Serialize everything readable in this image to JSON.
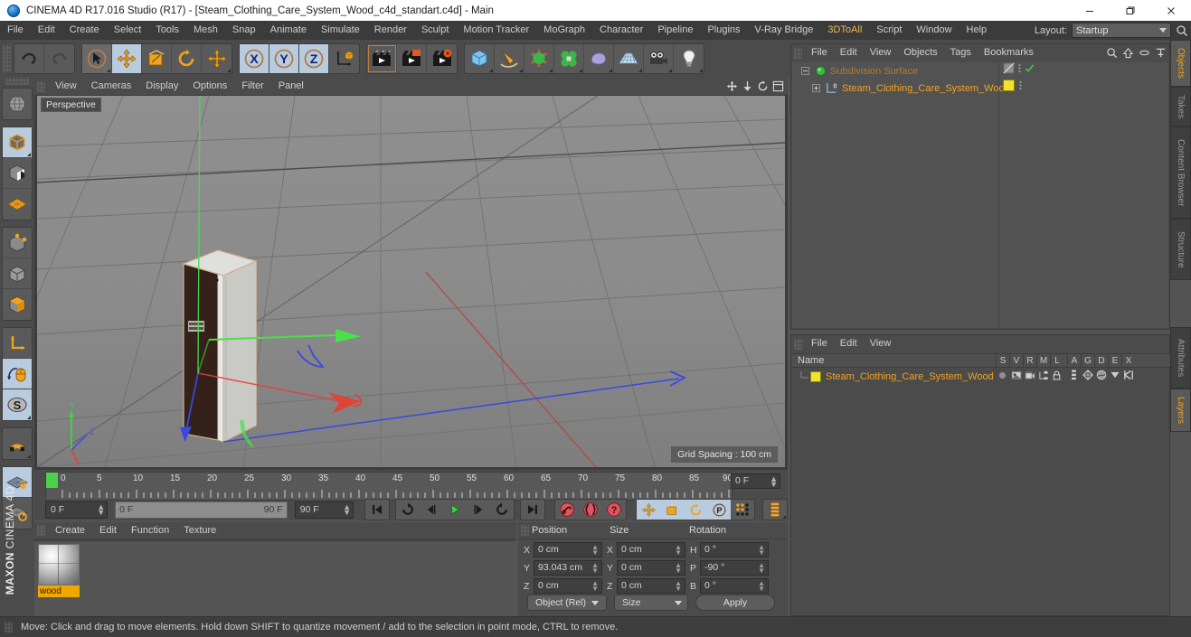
{
  "window": {
    "title": "CINEMA 4D R17.016 Studio (R17) - [Steam_Clothing_Care_System_Wood_c4d_standart.c4d] - Main",
    "app_icon": "c4d-logo-icon",
    "minimize": "minimize-icon",
    "maximize": "maximize-icon",
    "close": "close-icon"
  },
  "menubar": {
    "items": [
      {
        "label": "File"
      },
      {
        "label": "Edit"
      },
      {
        "label": "Create"
      },
      {
        "label": "Select"
      },
      {
        "label": "Tools"
      },
      {
        "label": "Mesh"
      },
      {
        "label": "Snap"
      },
      {
        "label": "Animate"
      },
      {
        "label": "Simulate"
      },
      {
        "label": "Render"
      },
      {
        "label": "Sculpt"
      },
      {
        "label": "Motion Tracker"
      },
      {
        "label": "MoGraph"
      },
      {
        "label": "Character"
      },
      {
        "label": "Pipeline"
      },
      {
        "label": "Plugins"
      },
      {
        "label": "V-Ray Bridge"
      },
      {
        "label": "3DToAll"
      },
      {
        "label": "Script"
      },
      {
        "label": "Window"
      },
      {
        "label": "Help"
      }
    ],
    "layout_label": "Layout:",
    "layout_value": "Startup",
    "search_icon": "search-icon"
  },
  "toolbar": {
    "groups": [
      {
        "buttons": [
          {
            "name": "undo-button",
            "icon": "undo-arrow-icon",
            "state": "normal"
          },
          {
            "name": "redo-button",
            "icon": "redo-arrow-icon",
            "state": "disabled"
          }
        ]
      },
      {
        "buttons": [
          {
            "name": "live-selection-tool",
            "icon": "cursor-arrow-icon",
            "state": "normal"
          },
          {
            "name": "move-tool",
            "icon": "move-cross-icon",
            "state": "selected"
          },
          {
            "name": "scale-tool",
            "icon": "scale-square-icon",
            "state": "normal"
          },
          {
            "name": "rotate-tool",
            "icon": "rotate-circle-icon",
            "state": "normal"
          },
          {
            "name": "dynamic-place-tool",
            "icon": "move-cross-icon",
            "state": "normal"
          }
        ]
      },
      {
        "buttons": [
          {
            "name": "x-axis-lock",
            "icon": "axis-x-icon",
            "state": "selected",
            "label": "X"
          },
          {
            "name": "y-axis-lock",
            "icon": "axis-y-icon",
            "state": "selected",
            "label": "Y"
          },
          {
            "name": "z-axis-lock",
            "icon": "axis-z-icon",
            "state": "selected",
            "label": "Z"
          },
          {
            "name": "world-object-coordinate-toggle",
            "icon": "world-axis-cube-icon",
            "state": "normal"
          }
        ]
      },
      {
        "buttons": [
          {
            "name": "render-view-button",
            "icon": "render-clapper-icon",
            "state": "active"
          },
          {
            "name": "render-region-button",
            "icon": "render-region-clapper-icon",
            "state": "normal"
          },
          {
            "name": "render-settings-button",
            "icon": "render-settings-clapper-icon",
            "state": "normal"
          }
        ]
      },
      {
        "buttons": [
          {
            "name": "add-cube-object",
            "icon": "cube-icon",
            "state": "normal"
          },
          {
            "name": "add-spline-object",
            "icon": "pen-spline-icon",
            "state": "normal"
          },
          {
            "name": "add-generator-object",
            "icon": "green-cube-generator-icon",
            "state": "normal"
          },
          {
            "name": "add-deformer-object",
            "icon": "green-clover-deformer-icon",
            "state": "normal"
          },
          {
            "name": "add-scene-object",
            "icon": "blob-environment-icon",
            "state": "normal"
          },
          {
            "name": "add-floor-object",
            "icon": "floor-grid-icon",
            "state": "normal"
          },
          {
            "name": "add-camera-object",
            "icon": "camera-icon",
            "state": "normal"
          },
          {
            "name": "add-light-object",
            "icon": "lightbulb-icon",
            "state": "normal"
          }
        ]
      }
    ]
  },
  "left_toolbar": {
    "groups": [
      {
        "buttons": [
          {
            "name": "make-editable-button",
            "icon": "make-editable-sphere-icon",
            "state": "normal"
          }
        ]
      },
      {
        "buttons": [
          {
            "name": "model-mode-button",
            "icon": "model-cube-icon",
            "state": "selected"
          },
          {
            "name": "texture-mode-button",
            "icon": "texture-checker-cube-icon",
            "state": "normal"
          },
          {
            "name": "workplane-mode-button",
            "icon": "workplane-grid-icon",
            "state": "normal"
          }
        ]
      },
      {
        "buttons": [
          {
            "name": "points-mode-button",
            "icon": "points-cube-icon",
            "state": "normal"
          },
          {
            "name": "edges-mode-button",
            "icon": "edges-cube-icon",
            "state": "normal"
          },
          {
            "name": "polygons-mode-button",
            "icon": "polygons-cube-icon",
            "state": "normal"
          }
        ]
      },
      {
        "buttons": [
          {
            "name": "object-axis-mode-button",
            "icon": "axis-corner-icon",
            "state": "normal"
          },
          {
            "name": "enable-axis-button",
            "icon": "mouse-axis-icon",
            "state": "selected"
          },
          {
            "name": "soft-selection-button",
            "icon": "soft-selection-s-icon",
            "state": "selected"
          }
        ]
      },
      {
        "buttons": [
          {
            "name": "snap-magnet-button",
            "icon": "magnet-icon",
            "state": "normal"
          }
        ]
      },
      {
        "buttons": [
          {
            "name": "lock-workplane-button",
            "icon": "locked-workplane-icon",
            "state": "selected"
          },
          {
            "name": "planar-workplane-button",
            "icon": "rotate-workplane-icon",
            "state": "normal"
          }
        ]
      }
    ],
    "brand_line1": "MAXON",
    "brand_line2": "CINEMA 4D"
  },
  "viewport": {
    "menu": [
      {
        "label": "View"
      },
      {
        "label": "Cameras"
      },
      {
        "label": "Display"
      },
      {
        "label": "Options"
      },
      {
        "label": "Filter"
      },
      {
        "label": "Panel"
      }
    ],
    "icons": [
      {
        "name": "viewport-move-icon"
      },
      {
        "name": "viewport-zoom-icon"
      },
      {
        "name": "viewport-rotate-icon"
      },
      {
        "name": "viewport-maximize-icon"
      }
    ],
    "label": "Perspective",
    "grid_spacing": "Grid Spacing : 100 cm",
    "axis_gizmo": {
      "y": "Y",
      "x": "X",
      "z": "Z"
    }
  },
  "timeline": {
    "ticks": [
      "0",
      "5",
      "10",
      "15",
      "20",
      "25",
      "30",
      "35",
      "40",
      "45",
      "50",
      "55",
      "60",
      "65",
      "70",
      "75",
      "80",
      "85",
      "90"
    ],
    "current_frame_marker": "0",
    "end_field": "0 F",
    "current_frame": "0 F",
    "range_start": "0 F",
    "range_end": "90 F",
    "preview_end": "90 F",
    "transport": [
      {
        "name": "go-to-start-button",
        "icon": "skip-start-icon"
      },
      {
        "name": "play-backwards-button",
        "icon": "loop-back-icon"
      },
      {
        "name": "previous-frame-button",
        "icon": "step-back-icon"
      },
      {
        "name": "play-forwards-button",
        "icon": "play-icon"
      },
      {
        "name": "next-frame-button",
        "icon": "step-forward-icon"
      },
      {
        "name": "play-forward-loop-button",
        "icon": "loop-forward-icon"
      },
      {
        "name": "go-to-end-button",
        "icon": "skip-end-icon"
      }
    ],
    "record_buttons": [
      {
        "name": "record-active-objects-button",
        "icon": "record-key-icon"
      },
      {
        "name": "autokeying-button",
        "icon": "autokey-icon"
      },
      {
        "name": "keyframe-selection-button",
        "icon": "key-question-icon"
      }
    ],
    "key_toggles": [
      {
        "name": "position-key-toggle",
        "icon": "move-cross-icon",
        "state": "selected"
      },
      {
        "name": "scale-key-toggle",
        "icon": "scale-square-icon",
        "state": "selected"
      },
      {
        "name": "rotation-key-toggle",
        "icon": "rotate-circle-icon",
        "state": "selected"
      },
      {
        "name": "parameter-key-toggle",
        "icon": "parameter-p-icon",
        "state": "selected"
      },
      {
        "name": "point-level-animation-toggle",
        "icon": "pla-dots-icon",
        "state": "normal"
      }
    ],
    "extra_button": {
      "name": "timeline-display-button",
      "icon": "timeline-strip-icon"
    }
  },
  "material_manager": {
    "menu": [
      {
        "label": "Create"
      },
      {
        "label": "Edit"
      },
      {
        "label": "Function"
      },
      {
        "label": "Texture"
      }
    ],
    "materials": [
      {
        "name": "wood",
        "preview": "material-sphere-preview",
        "selected": true
      }
    ]
  },
  "coordinates": {
    "headers": [
      "Position",
      "Size",
      "Rotation"
    ],
    "rows": [
      {
        "axis_pos": "X",
        "pos": "0 cm",
        "axis_size": "X",
        "size": "0 cm",
        "axis_rot": "H",
        "rot": "0 °"
      },
      {
        "axis_pos": "Y",
        "pos": "93.043 cm",
        "axis_size": "Y",
        "size": "0 cm",
        "axis_rot": "P",
        "rot": "-90 °"
      },
      {
        "axis_pos": "Z",
        "pos": "0 cm",
        "axis_size": "Z",
        "size": "0 cm",
        "axis_rot": "B",
        "rot": "0 °"
      }
    ],
    "mode_select": "Object (Rel)",
    "size_select": "Size",
    "apply_button": "Apply"
  },
  "object_manager": {
    "menu": [
      {
        "label": "File"
      },
      {
        "label": "Edit"
      },
      {
        "label": "View"
      },
      {
        "label": "Objects"
      },
      {
        "label": "Tags"
      },
      {
        "label": "Bookmarks"
      }
    ],
    "icons": [
      {
        "name": "object-search-icon"
      },
      {
        "name": "go-up-level-icon"
      },
      {
        "name": "hide-dots-icon"
      },
      {
        "name": "expand-all-icon"
      }
    ],
    "rows": [
      {
        "label": "Subdivision Surface",
        "icon": "subdivision-surface-icon",
        "indent": 0,
        "expander": "minus",
        "tag_icons": [
          "subdivision-tag-icon",
          "dots-icon",
          "green-check-icon"
        ],
        "dimmed": true
      },
      {
        "label": "Steam_Clothing_Care_System_Wood",
        "icon": "polygon-object-icon",
        "indent": 1,
        "expander": "plus",
        "tag_icons": [
          "yellow-material-tag-icon",
          "dots-icon"
        ],
        "dimmed": false
      }
    ]
  },
  "attribute_manager": {
    "menu": [
      {
        "label": "File"
      },
      {
        "label": "Edit"
      },
      {
        "label": "View"
      }
    ],
    "name_header": "Name",
    "columns": [
      "S",
      "V",
      "R",
      "M",
      "L",
      "A",
      "G",
      "D",
      "E",
      "X"
    ],
    "rows": [
      {
        "label": "Steam_Clothing_Care_System_Wood",
        "color_chip": "#f2e22b",
        "icons": [
          "solo-dot-icon",
          "view-icon",
          "render-icon",
          "manager-icon",
          "lock-icon",
          "animation-icon",
          "generator-icon",
          "deformer-icon",
          "expression-icon",
          "xpresso-icon"
        ]
      }
    ]
  },
  "vertical_tabs": {
    "top": [
      {
        "label": "Objects",
        "active": true
      },
      {
        "label": "Takes",
        "active": false
      },
      {
        "label": "Content Browser",
        "active": false
      },
      {
        "label": "Structure",
        "active": false
      }
    ],
    "bottom": [
      {
        "label": "Attributes",
        "active": false
      },
      {
        "label": "Layers",
        "active": true
      }
    ]
  },
  "statusbar": {
    "text": "Move: Click and drag to move elements. Hold down SHIFT to quantize movement / add to the selection in point mode, CTRL to remove."
  },
  "colors": {
    "accent_orange": "#f4a21c",
    "material_yellow": "#f2e22b",
    "selection_blue": "#b9ccdf",
    "panel_bg": "#4b4b4b",
    "viewport_bg": "#8b8b8b",
    "axis_x_red": "#e03a2f",
    "axis_y_green": "#3fd23f",
    "axis_z_blue": "#3a48e0"
  }
}
